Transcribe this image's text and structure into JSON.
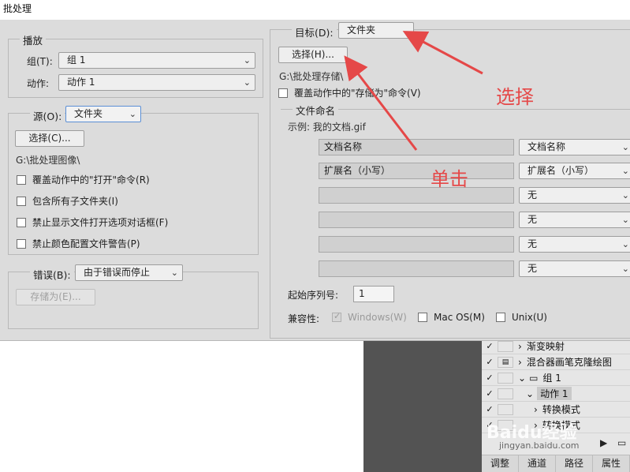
{
  "window": {
    "title": "批处理"
  },
  "play": {
    "legend": "播放",
    "set_label": "组(T):",
    "set_value": "组 1",
    "action_label": "动作:",
    "action_value": "动作 1"
  },
  "source": {
    "label": "源(O):",
    "value": "文件夹",
    "choose_label": "选择(C)...",
    "path": "G:\\批处理图像\\",
    "options": [
      {
        "label": "覆盖动作中的\"打开\"命令(R)",
        "checked": false
      },
      {
        "label": "包含所有子文件夹(I)",
        "checked": false
      },
      {
        "label": "禁止显示文件打开选项对话框(F)",
        "checked": false
      },
      {
        "label": "禁止颜色配置文件警告(P)",
        "checked": false
      }
    ]
  },
  "errors": {
    "label": "错误(B):",
    "value": "由于错误而停止",
    "save_as_label": "存储为(E)..."
  },
  "destination": {
    "label": "目标(D):",
    "value": "文件夹",
    "choose_label": "选择(H)...",
    "path": "G:\\批处理存储\\",
    "override_label": "覆盖动作中的\"存储为\"命令(V)"
  },
  "naming": {
    "legend": "文件命名",
    "example": "示例: 我的文档.gif",
    "rows": [
      {
        "field": "文档名称",
        "option": "文档名称"
      },
      {
        "field": "扩展名（小写）",
        "option": "扩展名（小写）"
      },
      {
        "field": "",
        "option": "无"
      },
      {
        "field": "",
        "option": "无"
      },
      {
        "field": "",
        "option": "无"
      },
      {
        "field": "",
        "option": "无"
      }
    ],
    "serial_label": "起始序列号:",
    "serial_value": "1",
    "compat_label": "兼容性:",
    "compat": [
      {
        "label": "Windows(W)",
        "checked": true,
        "disabled": true
      },
      {
        "label": "Mac OS(M)",
        "checked": false,
        "disabled": false
      },
      {
        "label": "Unix(U)",
        "checked": false,
        "disabled": false
      }
    ]
  },
  "annotations": {
    "select": "选择",
    "click": "单击",
    "color": "#e54848"
  },
  "panel": {
    "rows": [
      {
        "text": "渐变映射",
        "icon": "›"
      },
      {
        "text": "混合器画笔克隆绘图",
        "icon": "›"
      },
      {
        "text": "组 1",
        "icon": "folder"
      },
      {
        "text": "动作 1",
        "icon": "⌄"
      },
      {
        "text": "转换模式",
        "icon": "›"
      },
      {
        "text": "转换模式",
        "icon": "›"
      }
    ],
    "tabs": [
      "调整",
      "通道",
      "路径",
      "属性"
    ]
  },
  "watermark": {
    "brand": "Baidu经验",
    "url": "jingyan.baidu.com"
  }
}
